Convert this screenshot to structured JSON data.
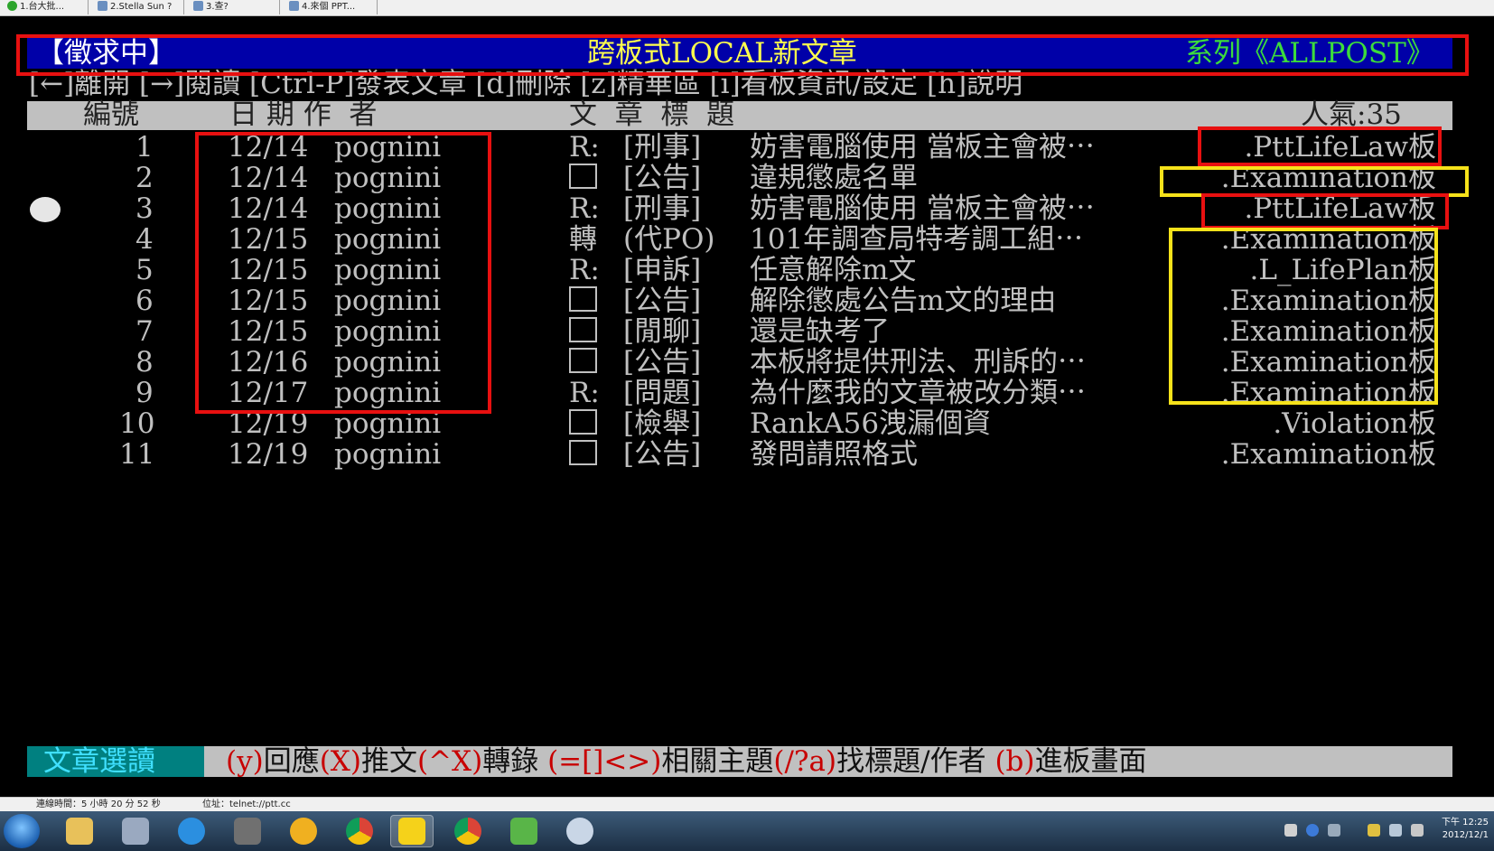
{
  "tabs": [
    {
      "label": "1.台大批..."
    },
    {
      "label": "2.Stella Sun ?"
    },
    {
      "label": "3.查?"
    },
    {
      "label": "4.來個 PPT..."
    }
  ],
  "header": {
    "left": "【徵求中】",
    "center": "跨板式LOCAL新文章",
    "right": "系列《ALLPOST》"
  },
  "help_line": "[←]離開 [→]閱讀 [Ctrl-P]發表文章 [d]刪除 [z]精華區 [i]看板資訊/設定 [h]說明",
  "columns": {
    "num": "編號",
    "date_author": "日 期 作  者",
    "title": "文  章  標  題",
    "popularity": "人氣:35"
  },
  "rows": [
    {
      "num": "1",
      "date": "12/14",
      "author": "pognini",
      "mark": "R:",
      "tag": "[刑事]",
      "title": "妨害電腦使用 當板主會被⋯",
      "board": ".PttLifeLaw板"
    },
    {
      "num": "2",
      "date": "12/14",
      "author": "pognini",
      "mark": "□",
      "tag": "[公告]",
      "title": "違規懲處名單",
      "board": ".Examination板"
    },
    {
      "num": "3",
      "date": "12/14",
      "author": "pognini",
      "mark": "R:",
      "tag": "[刑事]",
      "title": "妨害電腦使用 當板主會被⋯",
      "board": ".PttLifeLaw板"
    },
    {
      "num": "4",
      "date": "12/15",
      "author": "pognini",
      "mark": "轉",
      "tag": "(代PO)",
      "title": "101年調查局特考調工組⋯",
      "board": ".Examination板"
    },
    {
      "num": "5",
      "date": "12/15",
      "author": "pognini",
      "mark": "R:",
      "tag": "[申訴]",
      "title": "任意解除m文",
      "board": ".L_LifePlan板"
    },
    {
      "num": "6",
      "date": "12/15",
      "author": "pognini",
      "mark": "□",
      "tag": "[公告]",
      "title": "解除懲處公告m文的理由",
      "board": ".Examination板"
    },
    {
      "num": "7",
      "date": "12/15",
      "author": "pognini",
      "mark": "□",
      "tag": "[閒聊]",
      "title": "還是缺考了",
      "board": ".Examination板"
    },
    {
      "num": "8",
      "date": "12/16",
      "author": "pognini",
      "mark": "□",
      "tag": "[公告]",
      "title": "本板將提供刑法、刑訴的⋯",
      "board": ".Examination板"
    },
    {
      "num": "9",
      "date": "12/17",
      "author": "pognini",
      "mark": "R:",
      "tag": "[問題]",
      "title": "為什麼我的文章被改分類⋯",
      "board": ".Examination板"
    },
    {
      "num": "10",
      "date": "12/19",
      "author": "pognini",
      "mark": "□",
      "tag": "[檢舉]",
      "title": "RankA56洩漏個資",
      "board": ".Violation板"
    },
    {
      "num": "11",
      "date": "12/19",
      "author": "pognini",
      "mark": "□",
      "tag": "[公告]",
      "title": "發問請照格式",
      "board": ".Examination板"
    }
  ],
  "footer": {
    "label": "文章選讀",
    "commands": [
      {
        "key": "(y)",
        "text": "回應"
      },
      {
        "key": "(X)",
        "text": "推文"
      },
      {
        "key": "(^X)",
        "text": "轉錄 "
      },
      {
        "key": "(=[]<>)",
        "text": "相關主題"
      },
      {
        "key": "(/?a)",
        "text": "找標題/作者 "
      },
      {
        "key": "(b)",
        "text": "進板畫面"
      }
    ]
  },
  "status": {
    "connection": "連線時間：5 小時 20 分 52 秒",
    "address": "位址：telnet://ptt.cc"
  },
  "clock": {
    "time": "下午 12:25",
    "date": "2012/12/1"
  },
  "colors": {
    "header_bg": "#0000a8",
    "highlight_red": "#e81010",
    "highlight_yellow": "#f6e21a"
  }
}
